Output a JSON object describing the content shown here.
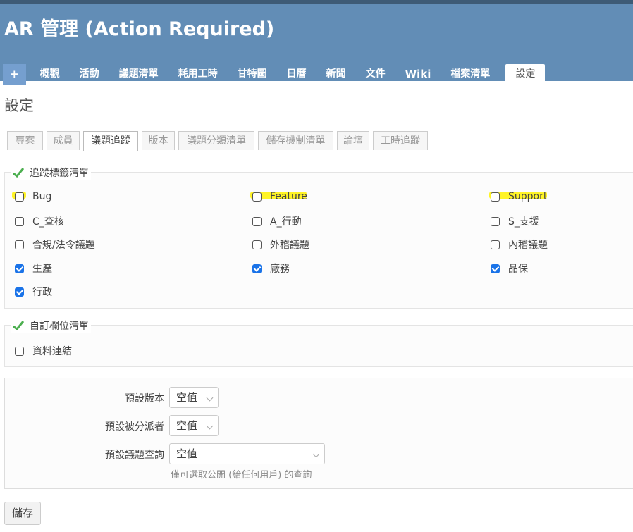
{
  "project": {
    "title": "AR 管理 (Action Required)"
  },
  "menu": {
    "new": "+",
    "items": [
      "概觀",
      "活動",
      "議題清單",
      "耗用工時",
      "甘特圖",
      "日曆",
      "新聞",
      "文件",
      "Wiki",
      "檔案清單",
      "設定"
    ]
  },
  "page": {
    "title": "設定"
  },
  "tabs": [
    "專案",
    "成員",
    "議題追蹤",
    "版本",
    "議題分類清單",
    "儲存機制清單",
    "論壇",
    "工時追蹤"
  ],
  "trackers": {
    "legend": "追蹤標籤清單",
    "items": [
      {
        "label": "Bug",
        "checked": false,
        "highlighted": true
      },
      {
        "label": "Feature",
        "checked": false,
        "highlighted": true
      },
      {
        "label": "Support",
        "checked": false,
        "highlighted": true
      },
      {
        "label": "C_查核",
        "checked": false
      },
      {
        "label": "A_行動",
        "checked": false
      },
      {
        "label": "S_支援",
        "checked": false
      },
      {
        "label": "合規/法令議題",
        "checked": false
      },
      {
        "label": "外稽議題",
        "checked": false
      },
      {
        "label": "內稽議題",
        "checked": false
      },
      {
        "label": "生產",
        "checked": true
      },
      {
        "label": "廠務",
        "checked": true
      },
      {
        "label": "品保",
        "checked": true
      },
      {
        "label": "行政",
        "checked": true
      }
    ]
  },
  "custom_fields": {
    "legend": "自訂欄位清單",
    "items": [
      {
        "label": "資料連結",
        "checked": false
      }
    ]
  },
  "defaults": {
    "version_label": "預設版本",
    "version_value": "空值",
    "assignee_label": "預設被分派者",
    "assignee_value": "空值",
    "query_label": "預設議題查詢",
    "query_value": "空值",
    "query_hint": "僅可選取公開 (給任何用戶) 的查詢"
  },
  "save_label": "儲存",
  "colors": {
    "header": "#628db6",
    "highlight": "#fff200",
    "checkbox": "#1a73e8",
    "check_icon": "#4caf50"
  }
}
